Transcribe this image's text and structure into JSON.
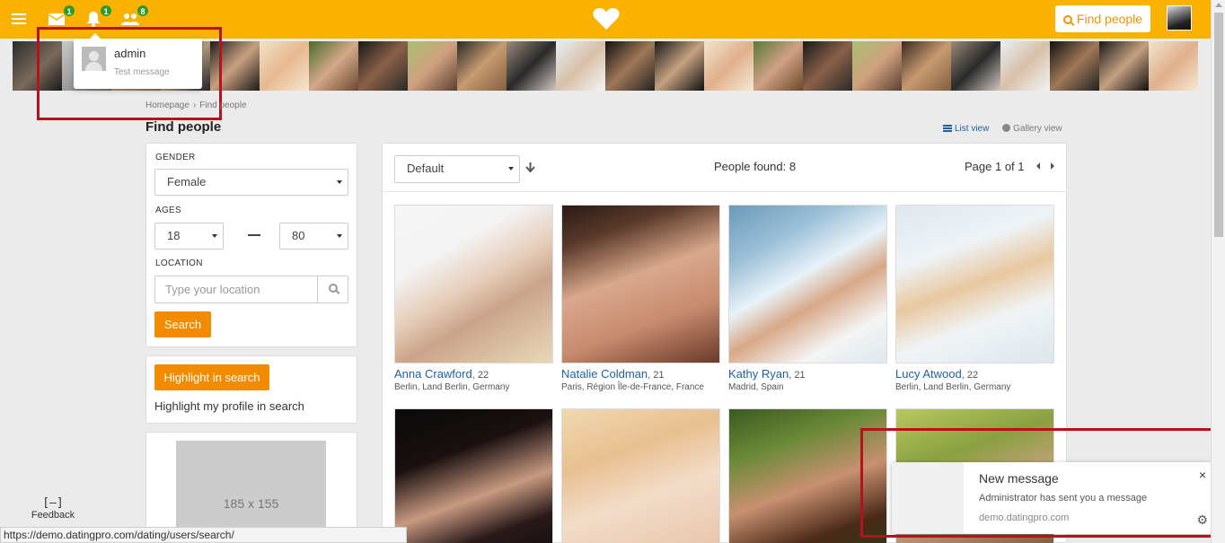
{
  "topbar": {
    "messages_badge": "1",
    "notifications_badge": "1",
    "friends_badge": "8",
    "find_people_label": "Find people",
    "accent_color": "#fbb100"
  },
  "notification_dropdown": {
    "sender": "admin",
    "message": "Test message"
  },
  "breadcrumb": {
    "home": "Homepage",
    "separator": "›",
    "current": "Find people"
  },
  "page_title": "Find people",
  "views": {
    "list": "List view",
    "gallery": "Gallery view"
  },
  "search": {
    "gender_label": "GENDER",
    "gender_value": "Female",
    "ages_label": "AGES",
    "age_from": "18",
    "age_to": "80",
    "location_label": "LOCATION",
    "location_placeholder": "Type your location",
    "search_button": "Search"
  },
  "highlight": {
    "button": "Highlight in search",
    "text": "Highlight my profile in search"
  },
  "ad": {
    "placeholder": "185 x 155"
  },
  "results": {
    "sort_value": "Default",
    "found_text": "People found: 8",
    "page_text": "Page 1 of 1",
    "people": [
      {
        "name": "Anna Crawford",
        "age": ", 22",
        "location": "Berlin, Land Berlin, Germany"
      },
      {
        "name": "Natalie Coldman",
        "age": ", 21",
        "location": "Paris, Région Île-de-France, France"
      },
      {
        "name": "Kathy Ryan",
        "age": ", 21",
        "location": "Madrid, Spain"
      },
      {
        "name": "Lucy Atwood",
        "age": ", 22",
        "location": "Berlin, Land Berlin, Germany"
      }
    ]
  },
  "feedback": {
    "icon": "[–]",
    "label": "Feedback"
  },
  "status_url": "https://demo.datingpro.com/dating/users/search/",
  "toast": {
    "title": "New message",
    "body": "Administrator has sent you a message",
    "source": "demo.datingpro.com",
    "close": "×",
    "gear": "⚙"
  }
}
